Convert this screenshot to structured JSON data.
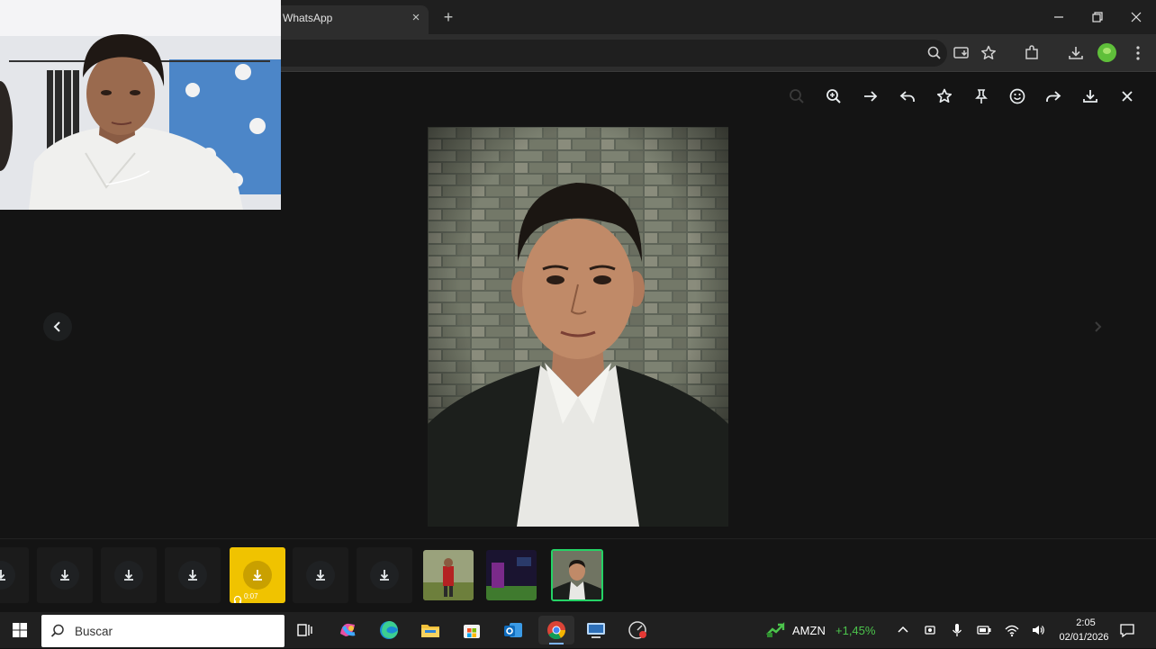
{
  "browser": {
    "tab_title": "WhatsApp",
    "tab_close": "×",
    "new_tab": "+",
    "window_controls": [
      "minimize-icon",
      "restore-icon",
      "close-icon"
    ],
    "toolbar_icons": [
      "zoom-icon",
      "install-app-icon",
      "bookmark-star-icon",
      "extensions-icon",
      "downloads-icon",
      "profile-avatar",
      "menu-icon"
    ]
  },
  "viewer": {
    "toolbar_icons": [
      "zoom-out-icon",
      "zoom-in-icon",
      "go-to-message-icon",
      "reply-icon",
      "star-icon",
      "pin-icon",
      "react-icon",
      "forward-icon",
      "download-icon",
      "close-icon"
    ],
    "audio_duration": "0:07",
    "selected_thumbnail_index": 9,
    "accent_color": "#25d366",
    "audio_tile_color": "#f0c300"
  },
  "taskbar": {
    "search_placeholder": "Buscar",
    "stock_symbol": "AMZN",
    "stock_change": "+1,45%",
    "time": "2:05",
    "date": "02/01/2026"
  }
}
